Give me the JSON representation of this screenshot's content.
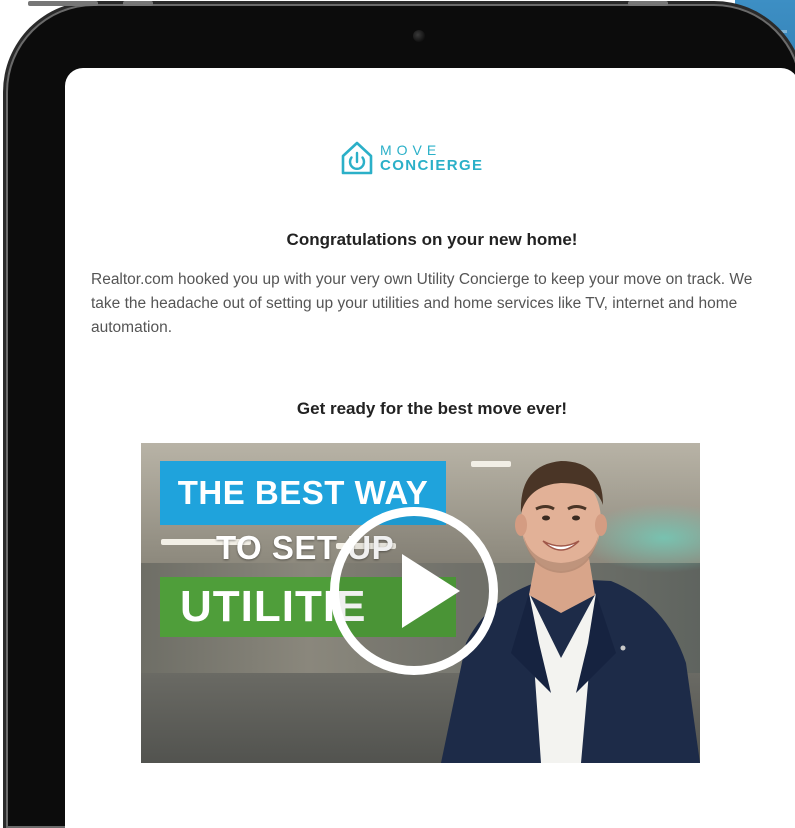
{
  "logo": {
    "word_top": "MOVE",
    "word_bottom": "CONCIERGE",
    "icon": "house-power-icon",
    "color": "#2bb0c8"
  },
  "email": {
    "headline": "Congratulations on your new home!",
    "body": "Realtor.com hooked you up with your very own Utility Concierge to keep your move on track. We take the headache out of setting up your utilities and home services like TV, internet and home automation.",
    "subheadline": "Get ready for the best move ever!"
  },
  "video": {
    "line1": "THE BEST WAY",
    "line2": "TO SET UP",
    "line3": "UTILITIE",
    "play_icon": "play-icon",
    "colors": {
      "blue": "#1fa3dc",
      "green": "#4f9e3a"
    }
  }
}
